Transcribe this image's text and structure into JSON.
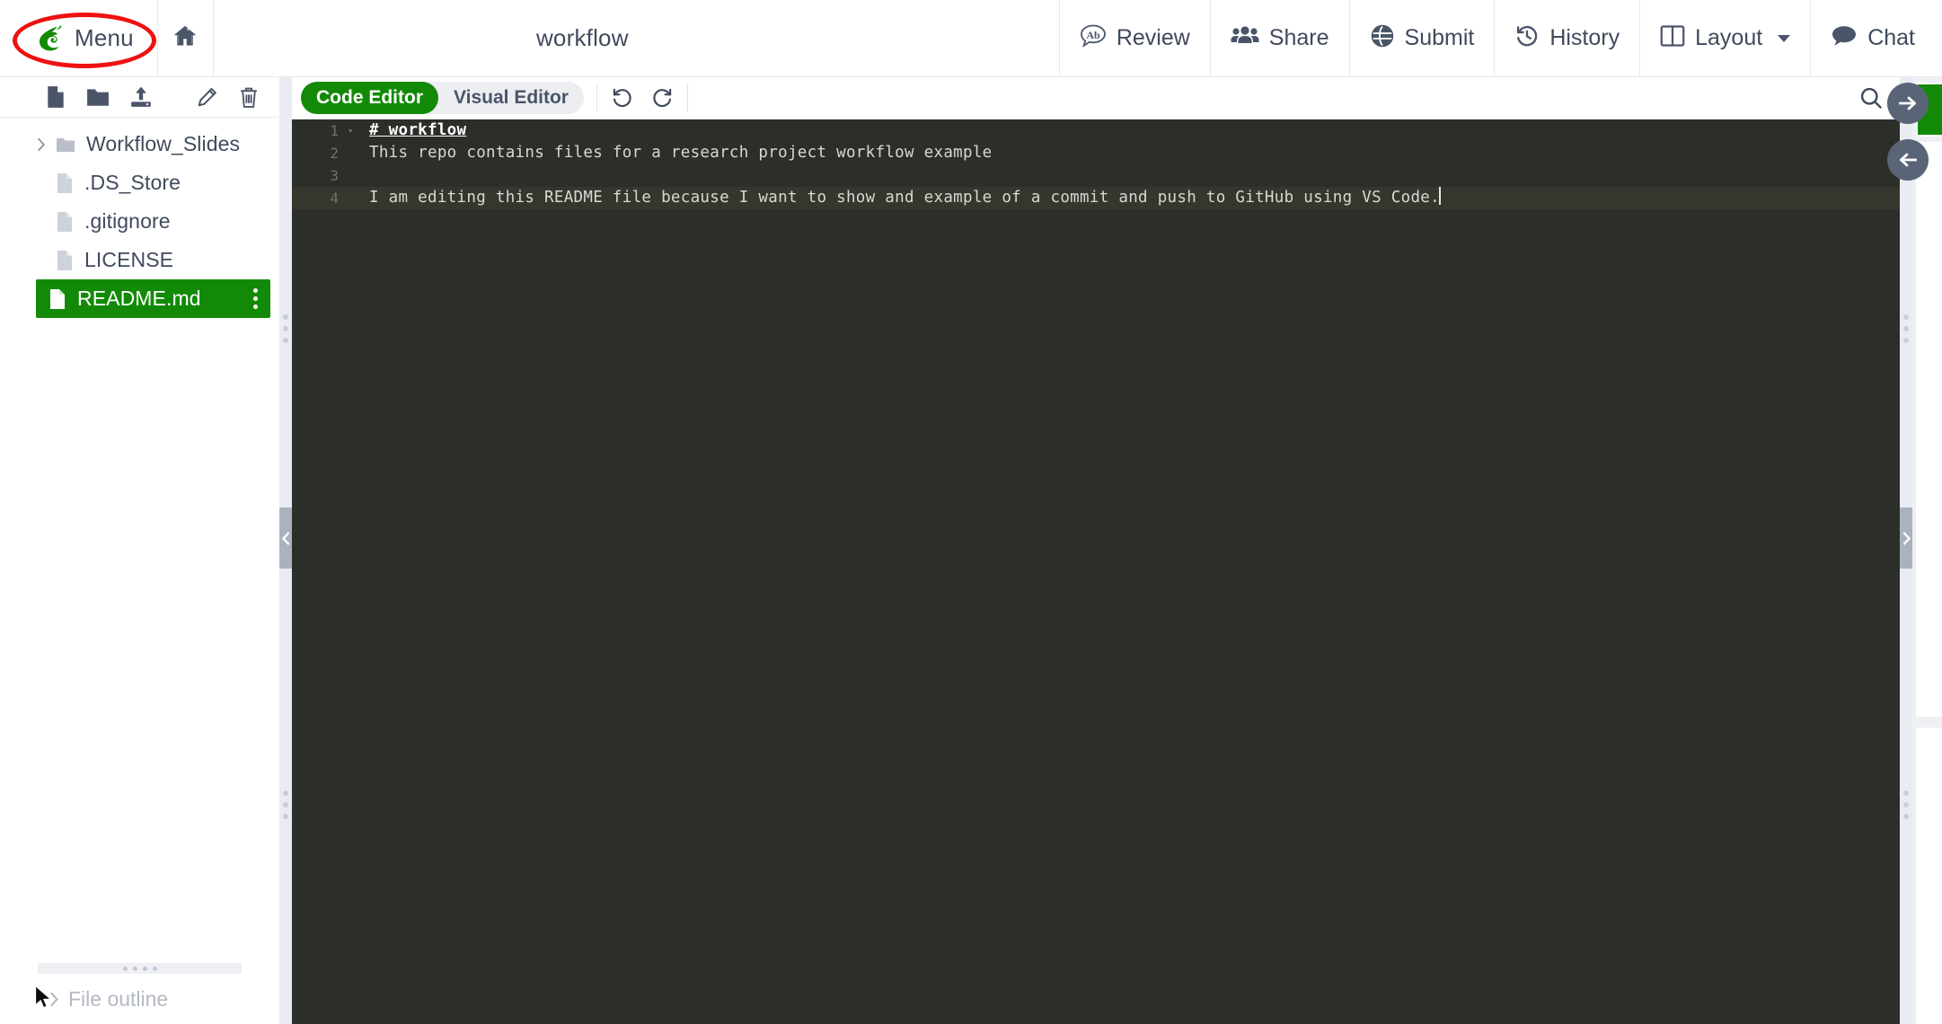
{
  "app": {
    "name": "Overleaf",
    "project_title": "workflow"
  },
  "colors": {
    "brand_green": "#138a07",
    "header_text": "#3f4a5c",
    "annotation_red": "#ee1111",
    "editor_bg": "#2c2e29",
    "editor_text": "#d8d8d2",
    "splitter": "#e9ecf2"
  },
  "header": {
    "menu_label": "Menu",
    "menu_icon": "overleaf-logo-icon",
    "home_icon": "home-icon",
    "title": "workflow",
    "actions": [
      {
        "label": "Review",
        "icon": "review-ab-icon"
      },
      {
        "label": "Share",
        "icon": "share-people-icon"
      },
      {
        "label": "Submit",
        "icon": "submit-globe-icon"
      },
      {
        "label": "History",
        "icon": "history-clock-icon"
      },
      {
        "label": "Layout",
        "icon": "layout-columns-icon",
        "has_caret": true
      },
      {
        "label": "Chat",
        "icon": "chat-bubble-icon"
      }
    ]
  },
  "file_tree": {
    "toolbar": {
      "new_file": "new-file-icon",
      "new_folder": "new-folder-icon",
      "upload": "upload-icon",
      "rename": "pencil-edit-icon",
      "delete": "trash-icon"
    },
    "items": [
      {
        "name": "Workflow_Slides",
        "type": "folder",
        "expandable": true,
        "selected": false
      },
      {
        "name": ".DS_Store",
        "type": "file",
        "expandable": false,
        "selected": false
      },
      {
        "name": ".gitignore",
        "type": "file",
        "expandable": false,
        "selected": false
      },
      {
        "name": "LICENSE",
        "type": "file",
        "expandable": false,
        "selected": false
      },
      {
        "name": "README.md",
        "type": "file",
        "expandable": false,
        "selected": true
      }
    ],
    "outline_label": "File outline",
    "outline_expanded": false
  },
  "editor": {
    "tabs": [
      {
        "label": "Code Editor",
        "active": true
      },
      {
        "label": "Visual Editor",
        "active": false
      }
    ],
    "undo_icon": "undo-arrow-icon",
    "redo_icon": "redo-arrow-icon",
    "search_icon": "search-icon",
    "lines": [
      {
        "number": "1",
        "text": "# workflow",
        "heading": true,
        "foldable": true,
        "active": false
      },
      {
        "number": "2",
        "text": "This repo contains files for a research project workflow example",
        "heading": false,
        "foldable": false,
        "active": false
      },
      {
        "number": "3",
        "text": "",
        "heading": false,
        "foldable": false,
        "active": false
      },
      {
        "number": "4",
        "text": "I am editing this README file because I want to show and example of a commit and push to GitHub using VS Code.",
        "heading": false,
        "foldable": false,
        "active": true
      }
    ]
  },
  "pdf_panel": {
    "next_page_icon": "arrow-right-circle-icon",
    "prev_page_icon": "arrow-left-circle-icon"
  }
}
